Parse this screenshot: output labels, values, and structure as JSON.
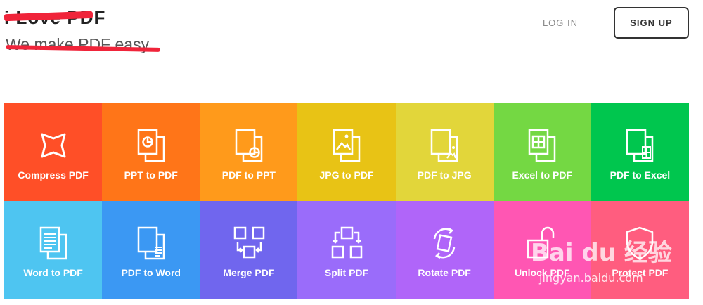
{
  "header": {
    "logo_text": "i Love PDF",
    "tagline": "We make PDF easy.",
    "nav": {
      "login_label": "LOG IN",
      "signup_label": "SIGN UP"
    }
  },
  "tools": [
    {
      "label": "Compress PDF",
      "color": "#ff4f27",
      "icon": "compress-icon"
    },
    {
      "label": "PPT to PDF",
      "color": "#ff7518",
      "icon": "ppt-to-pdf-icon"
    },
    {
      "label": "PDF to PPT",
      "color": "#ff9a1b",
      "icon": "pdf-to-ppt-icon"
    },
    {
      "label": "JPG to PDF",
      "color": "#e8c315",
      "icon": "jpg-to-pdf-icon"
    },
    {
      "label": "PDF to JPG",
      "color": "#e2d63a",
      "icon": "pdf-to-jpg-icon"
    },
    {
      "label": "Excel to PDF",
      "color": "#74d843",
      "icon": "excel-to-pdf-icon"
    },
    {
      "label": "PDF to Excel",
      "color": "#00c64e",
      "icon": "pdf-to-excel-icon"
    },
    {
      "label": "Word to PDF",
      "color": "#4ec5f1",
      "icon": "word-to-pdf-icon"
    },
    {
      "label": "PDF to Word",
      "color": "#3b98f3",
      "icon": "pdf-to-word-icon"
    },
    {
      "label": "Merge PDF",
      "color": "#7066ee",
      "icon": "merge-icon"
    },
    {
      "label": "Split PDF",
      "color": "#9a6cfa",
      "icon": "split-icon"
    },
    {
      "label": "Rotate PDF",
      "color": "#b065f9",
      "icon": "rotate-icon"
    },
    {
      "label": "Unlock PDF",
      "color": "#ff56b3",
      "icon": "unlock-icon"
    },
    {
      "label": "Protect PDF",
      "color": "#ff5d7f",
      "icon": "protect-icon"
    }
  ],
  "watermark": {
    "brand": "Bai du 经验",
    "url": "jingyan.baidu.com"
  }
}
